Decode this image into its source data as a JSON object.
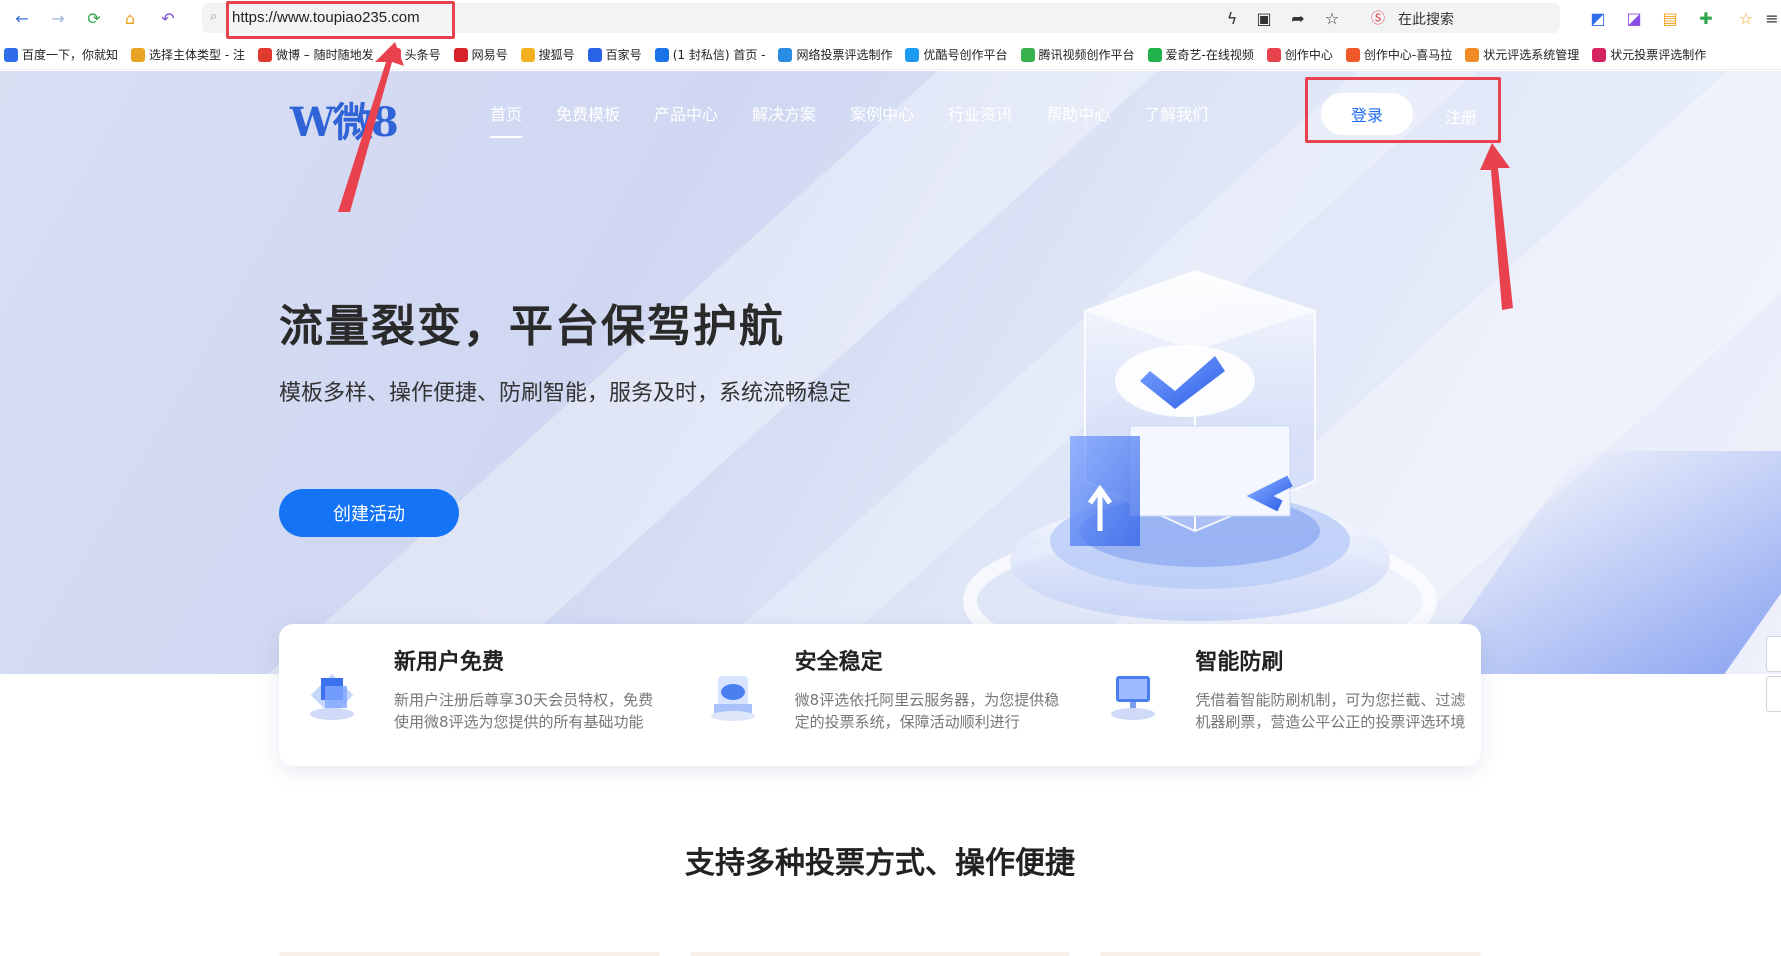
{
  "browser": {
    "url": "https://www.toupiao235.com",
    "search_hint": "在此搜索",
    "bookmarks": [
      {
        "label": "百度一下，你就知",
        "color": "#2f6ee8"
      },
      {
        "label": "选择主体类型 - 注",
        "color": "#e7a321"
      },
      {
        "label": "微博 – 随时随地发",
        "color": "#e03a2f"
      },
      {
        "label": "头条号",
        "color": "#e8424f"
      },
      {
        "label": "网易号",
        "color": "#d8232a"
      },
      {
        "label": "搜狐号",
        "color": "#f3b021"
      },
      {
        "label": "百家号",
        "color": "#2a62e8"
      },
      {
        "label": "(1 封私信) 首页 -",
        "color": "#1a74e8"
      },
      {
        "label": "网络投票评选制作",
        "color": "#2a8ce0"
      },
      {
        "label": "优酷号创作平台",
        "color": "#1d9bf0"
      },
      {
        "label": "腾讯视频创作平台",
        "color": "#37b24d"
      },
      {
        "label": "爱奇艺-在线视频",
        "color": "#22b24c"
      },
      {
        "label": "创作中心",
        "color": "#e8424f"
      },
      {
        "label": "创作中心-喜马拉",
        "color": "#f05a28"
      },
      {
        "label": "状元评选系统管理",
        "color": "#f08c28"
      },
      {
        "label": "状元投票评选制作",
        "color": "#d6245f"
      }
    ]
  },
  "header": {
    "logo": "W微8",
    "nav": [
      "首页",
      "免费模板",
      "产品中心",
      "解决方案",
      "案例中心",
      "行业资讯",
      "帮助中心",
      "了解我们"
    ],
    "login": "登录",
    "register": "注册"
  },
  "hero": {
    "title": "流量裂变，平台保驾护航",
    "subtitle": "模板多样、操作便捷、防刷智能，服务及时，系统流畅稳定",
    "cta": "创建活动"
  },
  "features": [
    {
      "title": "新用户免费",
      "desc": "新用户注册后尊享30天会员特权，免费使用微8评选为您提供的所有基础功能",
      "icon": "cube-stack-icon"
    },
    {
      "title": "安全稳定",
      "desc": "微8评选依托阿里云服务器，为您提供稳定的投票系统，保障活动顺利进行",
      "icon": "cloud-server-icon"
    },
    {
      "title": "智能防刷",
      "desc": "凭借着智能防刷机制，可为您拦截、过滤机器刷票，营造公平公正的投票评选环境",
      "icon": "monitor-shield-icon"
    }
  ],
  "section": {
    "title": "支持多种投票方式、操作便捷"
  },
  "colors": {
    "accent": "#1474f5",
    "annotation": "#e8424f"
  }
}
